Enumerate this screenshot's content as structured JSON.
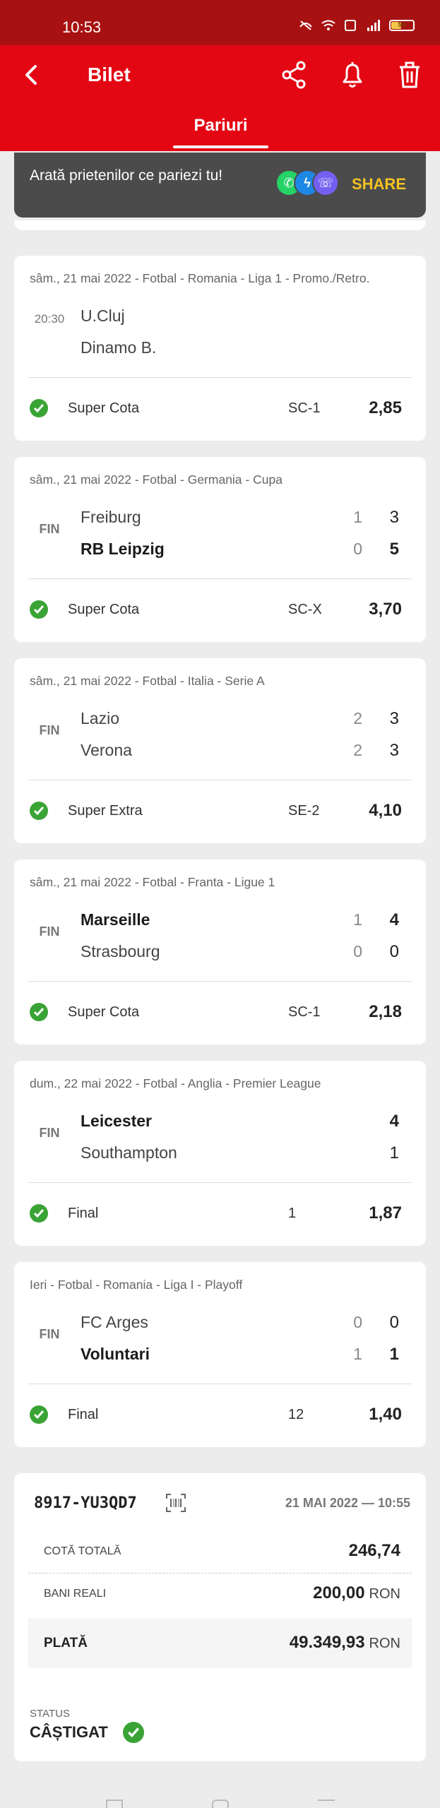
{
  "status_bar": {
    "time": "10:53",
    "battery": "56"
  },
  "header": {
    "title": "Bilet",
    "tab": "Pariuri"
  },
  "share_banner": {
    "text": "Arată prietenilor ce pariezi tu!",
    "button": "SHARE"
  },
  "bets": [
    {
      "title": "sâm., 21 mai 2022 - Fotbal - Romania - Liga 1 - Promo./Retro.",
      "status": "20:30",
      "team1": "U.Cluj",
      "team2": "Dinamo B.",
      "ht1": "",
      "ht2": "",
      "ft1": "",
      "ft2": "",
      "market": "Super Cota",
      "pick": "SC-1",
      "odds": "2,85"
    },
    {
      "title": "sâm., 21 mai 2022 - Fotbal - Germania - Cupa",
      "status": "FIN",
      "team1": "Freiburg",
      "team2": "RB Leipzig",
      "ht1": "1",
      "ht2": "0",
      "ft1": "3",
      "ft2": "5",
      "market": "Super Cota",
      "pick": "SC-X",
      "odds": "3,70"
    },
    {
      "title": "sâm., 21 mai 2022 - Fotbal - Italia - Serie A",
      "status": "FIN",
      "team1": "Lazio",
      "team2": "Verona",
      "ht1": "2",
      "ht2": "2",
      "ft1": "3",
      "ft2": "3",
      "market": "Super Extra",
      "pick": "SE-2",
      "odds": "4,10"
    },
    {
      "title": "sâm., 21 mai 2022 - Fotbal - Franta - Ligue 1",
      "status": "FIN",
      "team1": "Marseille",
      "team2": "Strasbourg",
      "ht1": "1",
      "ht2": "0",
      "ft1": "4",
      "ft2": "0",
      "market": "Super Cota",
      "pick": "SC-1",
      "odds": "2,18"
    },
    {
      "title": "dum., 22 mai 2022 - Fotbal - Anglia - Premier League",
      "status": "FIN",
      "team1": "Leicester",
      "team2": "Southampton",
      "ht1": "",
      "ht2": "",
      "ft1": "4",
      "ft2": "1",
      "market": "Final",
      "pick": "1",
      "odds": "1,87"
    },
    {
      "title": "Ieri - Fotbal - Romania - Liga I - Playoff",
      "status": "FIN",
      "team1": "FC Arges",
      "team2": "Voluntari",
      "ht1": "0",
      "ht2": "1",
      "ft1": "0",
      "ft2": "1",
      "market": "Final",
      "pick": "12",
      "odds": "1,40"
    }
  ],
  "summary": {
    "code": "8917-YU3QD7",
    "date": "21 MAI 2022 — 10:55",
    "total_odds_label": "COTĂ TOTALĂ",
    "total_odds": "246,74",
    "stake_label": "BANI REALI",
    "stake": "200,00",
    "currency": "RON",
    "payout_label": "PLATĂ",
    "payout": "49.349,93",
    "status_label": "STATUS",
    "status_value": "CÂȘTIGAT"
  },
  "colors": {
    "header": "#e30613",
    "statusbar": "#a81111",
    "share_accent": "#f3c221",
    "success": "#3aa335"
  }
}
